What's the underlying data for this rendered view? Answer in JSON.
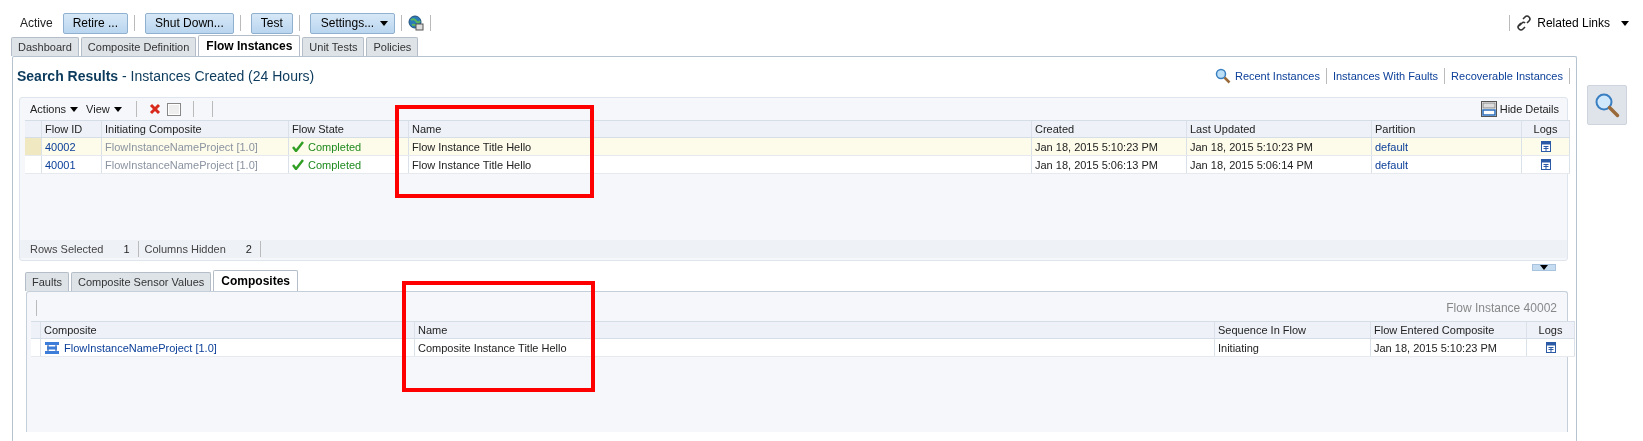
{
  "toolbar": {
    "status": "Active",
    "buttons": [
      {
        "label": "Retire ...",
        "kind": "button"
      },
      {
        "label": "Shut Down...",
        "kind": "button"
      },
      {
        "label": "Test",
        "kind": "button"
      },
      {
        "label": "Settings...",
        "kind": "dropdown"
      }
    ],
    "related_links": "Related Links"
  },
  "tabs": [
    {
      "label": "Dashboard",
      "selected": false
    },
    {
      "label": "Composite Definition",
      "selected": false
    },
    {
      "label": "Flow Instances",
      "selected": true
    },
    {
      "label": "Unit Tests",
      "selected": false
    },
    {
      "label": "Policies",
      "selected": false
    }
  ],
  "search": {
    "title": "Search Results",
    "subtitle": "- Instances Created (24 Hours)",
    "links": [
      "Recent Instances",
      "Instances With Faults",
      "Recoverable Instances"
    ]
  },
  "table": {
    "menus": [
      "Actions",
      "View"
    ],
    "hide_details": "Hide Details",
    "columns": [
      "Flow ID",
      "Initiating Composite",
      "Flow State",
      "Name",
      "Created",
      "Last Updated",
      "Partition",
      "Logs"
    ],
    "rows": [
      {
        "selected": true,
        "flow_id": "40002",
        "composite": "FlowInstanceNameProject [1.0]",
        "state": {
          "kind": "completed",
          "label": "Completed"
        },
        "name": "Flow Instance Title Hello",
        "created": "Jan 18, 2015 5:10:23 PM",
        "updated": "Jan 18, 2015 5:10:23 PM",
        "partition": "default"
      },
      {
        "selected": false,
        "flow_id": "40001",
        "composite": "FlowInstanceNameProject [1.0]",
        "state": {
          "kind": "completed",
          "label": "Completed"
        },
        "name": "Flow Instance Title Hello",
        "created": "Jan 18, 2015 5:06:13 PM",
        "updated": "Jan 18, 2015 5:06:14 PM",
        "partition": "default"
      }
    ],
    "footer": [
      {
        "label": "Rows Selected",
        "value": "1"
      },
      {
        "label": "Columns Hidden",
        "value": "2"
      }
    ]
  },
  "detail_tabs": [
    {
      "label": "Faults",
      "selected": false
    },
    {
      "label": "Composite Sensor Values",
      "selected": false
    },
    {
      "label": "Composites",
      "selected": true
    }
  ],
  "detail": {
    "caption": "Flow Instance 40002",
    "columns": [
      "Composite",
      "Name",
      "Sequence In Flow",
      "Flow Entered Composite",
      "Logs"
    ],
    "rows": [
      {
        "composite": "FlowInstanceNameProject [1.0]",
        "name": "Composite Instance Title Hello",
        "sequence": "Initiating",
        "entered": "Jan 18, 2015 5:10:23 PM"
      }
    ]
  }
}
